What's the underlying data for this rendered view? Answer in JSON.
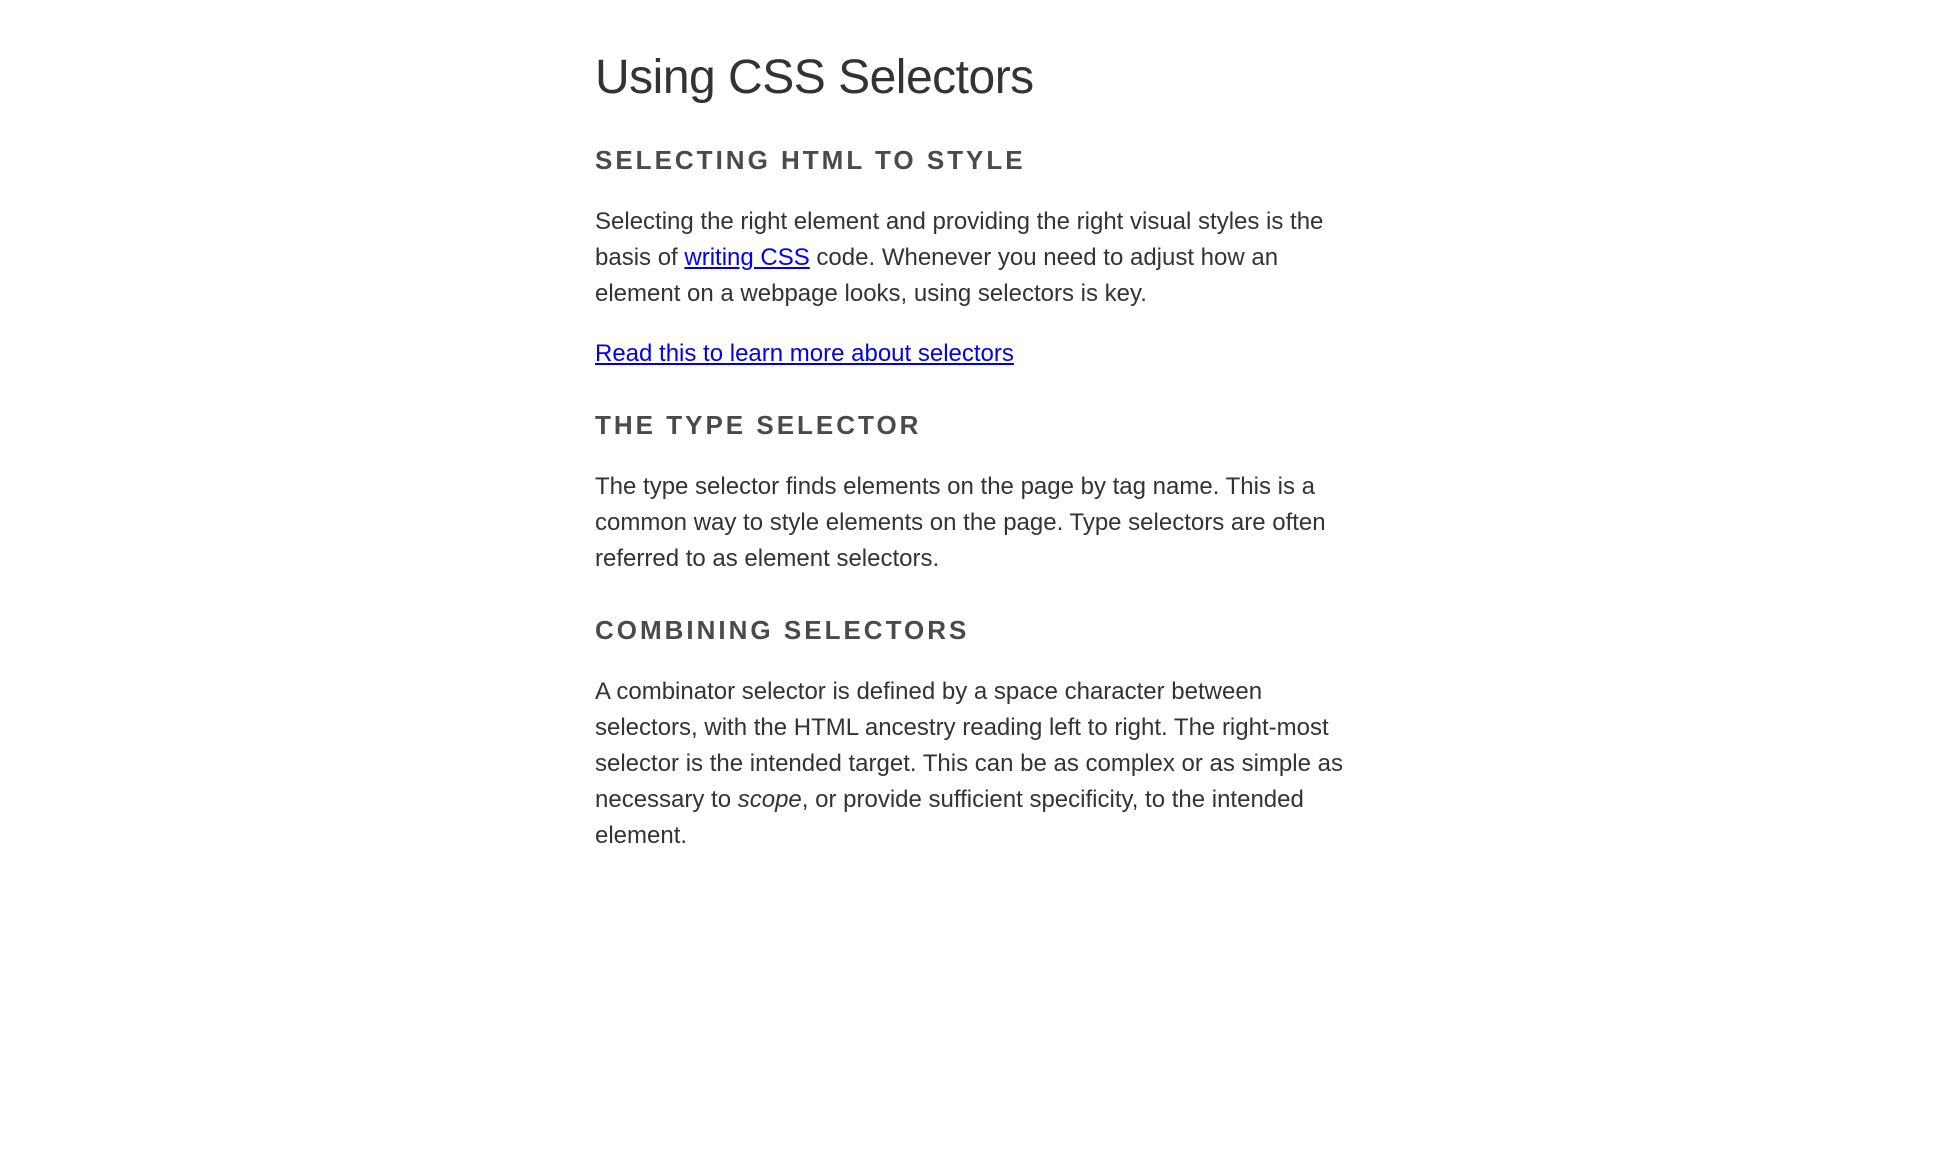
{
  "title": "Using CSS Selectors",
  "sections": [
    {
      "heading": "SELECTING HTML TO STYLE",
      "paragraph_before_link": "Selecting the right element and providing the right visual styles is the basis of ",
      "inline_link_text": "writing CSS",
      "paragraph_after_link": " code. Whenever you need to adjust how an element on a webpage looks, using selectors is key.",
      "standalone_link": "Read this to learn more about selectors"
    },
    {
      "heading": "THE TYPE SELECTOR",
      "paragraph": "The type selector finds elements on the page by tag name. This is a common way to style elements on the page. Type selectors are often referred to as element selectors."
    },
    {
      "heading": "COMBINING SELECTORS",
      "paragraph_before_em": "A combinator selector is defined by a space character between selectors, with the HTML ancestry reading left to right. The right-most selector is the intended target. This can be as complex or as simple as necessary to ",
      "em_text": "scope",
      "paragraph_after_em": ", or provide sufficient specificity, to the intended element."
    }
  ]
}
